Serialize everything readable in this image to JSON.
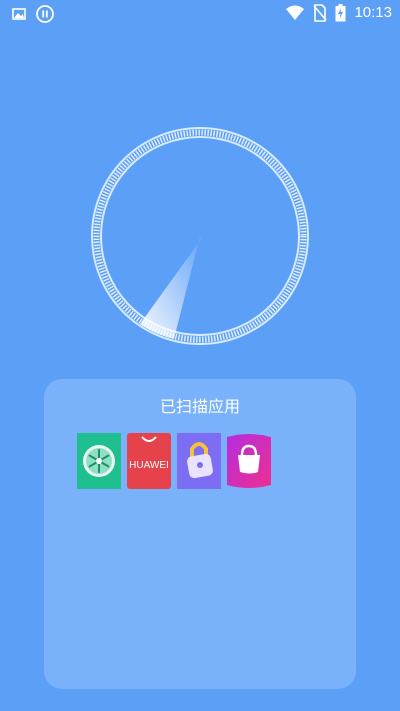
{
  "status_bar": {
    "time": "10:13",
    "left_icons": [
      "image-icon",
      "pause-circle-icon"
    ],
    "right_icons": [
      "wifi-icon",
      "no-sim-icon",
      "battery-charging-icon"
    ]
  },
  "scanner": {
    "state": "scanning",
    "sweep_icon": "radar-sweep"
  },
  "scanned_panel": {
    "title": "已扫描应用",
    "apps": [
      {
        "icon": "snowflake-app-icon",
        "color": "#1fbf8f"
      },
      {
        "icon": "huawei-appgallery-icon",
        "label": "HUAWEI",
        "color": "#e6424b"
      },
      {
        "icon": "lock-app-icon",
        "color": "#7c6df2"
      },
      {
        "icon": "shopping-bag-icon",
        "color": "#d52bd1"
      }
    ]
  },
  "colors": {
    "background": "#5b9ff7",
    "panel": "#79b2fa",
    "text": "#ffffff"
  }
}
